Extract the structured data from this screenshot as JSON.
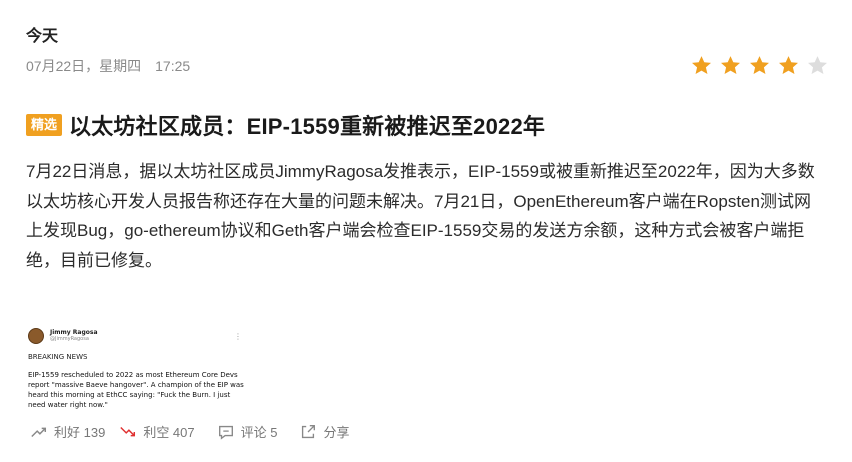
{
  "header": {
    "day_label": "今天",
    "date_time": "07月22日，星期四　17:25"
  },
  "rating": {
    "value": 4,
    "max": 5,
    "star_color": "#f0a020",
    "empty_color": "#dddddd"
  },
  "article": {
    "badge": "精选",
    "title": "以太坊社区成员：EIP-1559重新被推迟至2022年",
    "body": "7月22日消息，据以太坊社区成员JimmyRagosa发推表示，EIP-1559或被重新推迟至2022年，因为大多数以太坊核心开发人员报告称还存在大量的问题未解决。7月21日，OpenEthereum客户端在Ropsten测试网上发现Bug，go-ethereum协议和Geth客户端会检查EIP-1559交易的发送方余额，这种方式会被客户端拒绝，目前已修复。"
  },
  "tweet": {
    "name": "Jimmy Ragosa",
    "handle": "@JimmyRagosa",
    "breaking": "BREAKING NEWS",
    "text": "EIP-1559 rescheduled to 2022 as most Ethereum Core Devs report \"massive Baeve hangover\". A champion of the EIP was heard this morning at EthCC saying: \"Fuck the Burn. I just need water right now.\""
  },
  "actions": {
    "bullish": "利好 139",
    "bearish": "利空 407",
    "comment": "评论 5",
    "share": "分享"
  },
  "colors": {
    "accent": "#f0a020",
    "bearish_red": "#e03030"
  }
}
